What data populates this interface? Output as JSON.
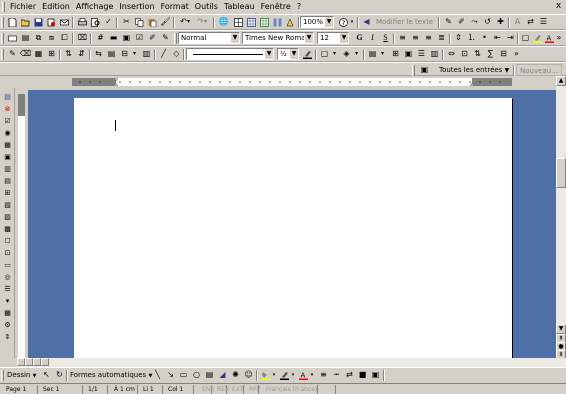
{
  "menu": {
    "items": [
      "Fichier",
      "Edition",
      "Affichage",
      "Insertion",
      "Format",
      "Outils",
      "Tableau",
      "Fenêtre",
      "?"
    ],
    "close_glyph": "x"
  },
  "standard_toolbar": {
    "zoom": "100%",
    "modify_text_label": "Modifier le texte"
  },
  "formatting_toolbar": {
    "style": "Normal",
    "font": "Times New Roman",
    "size": "12"
  },
  "extra_toolbar": {
    "line_width": "½"
  },
  "autotext_toolbar": {
    "all_entries_label": "Toutes les entrées",
    "new_label": "Nouveau..."
  },
  "drawing_toolbar": {
    "draw_label": "Dessin",
    "autoshapes_label": "Formes automatiques"
  },
  "status_bar": {
    "page": "Page 1",
    "section": "Sec 1",
    "page_of": "1/1",
    "at": "À 1 cm",
    "line": "Li 1",
    "col": "Col 1",
    "rec": "ENR",
    "rev": "REV",
    "ext": "EXT",
    "ovr": "RFP",
    "lang": "Français (France)"
  },
  "colors": {
    "chrome": "#d4d0c8",
    "document_background": "#4f70a6",
    "page": "#ffffff",
    "accent_blue": "#0a246a",
    "fill_yellow": "#ffff00",
    "font_red": "#ff0000"
  }
}
